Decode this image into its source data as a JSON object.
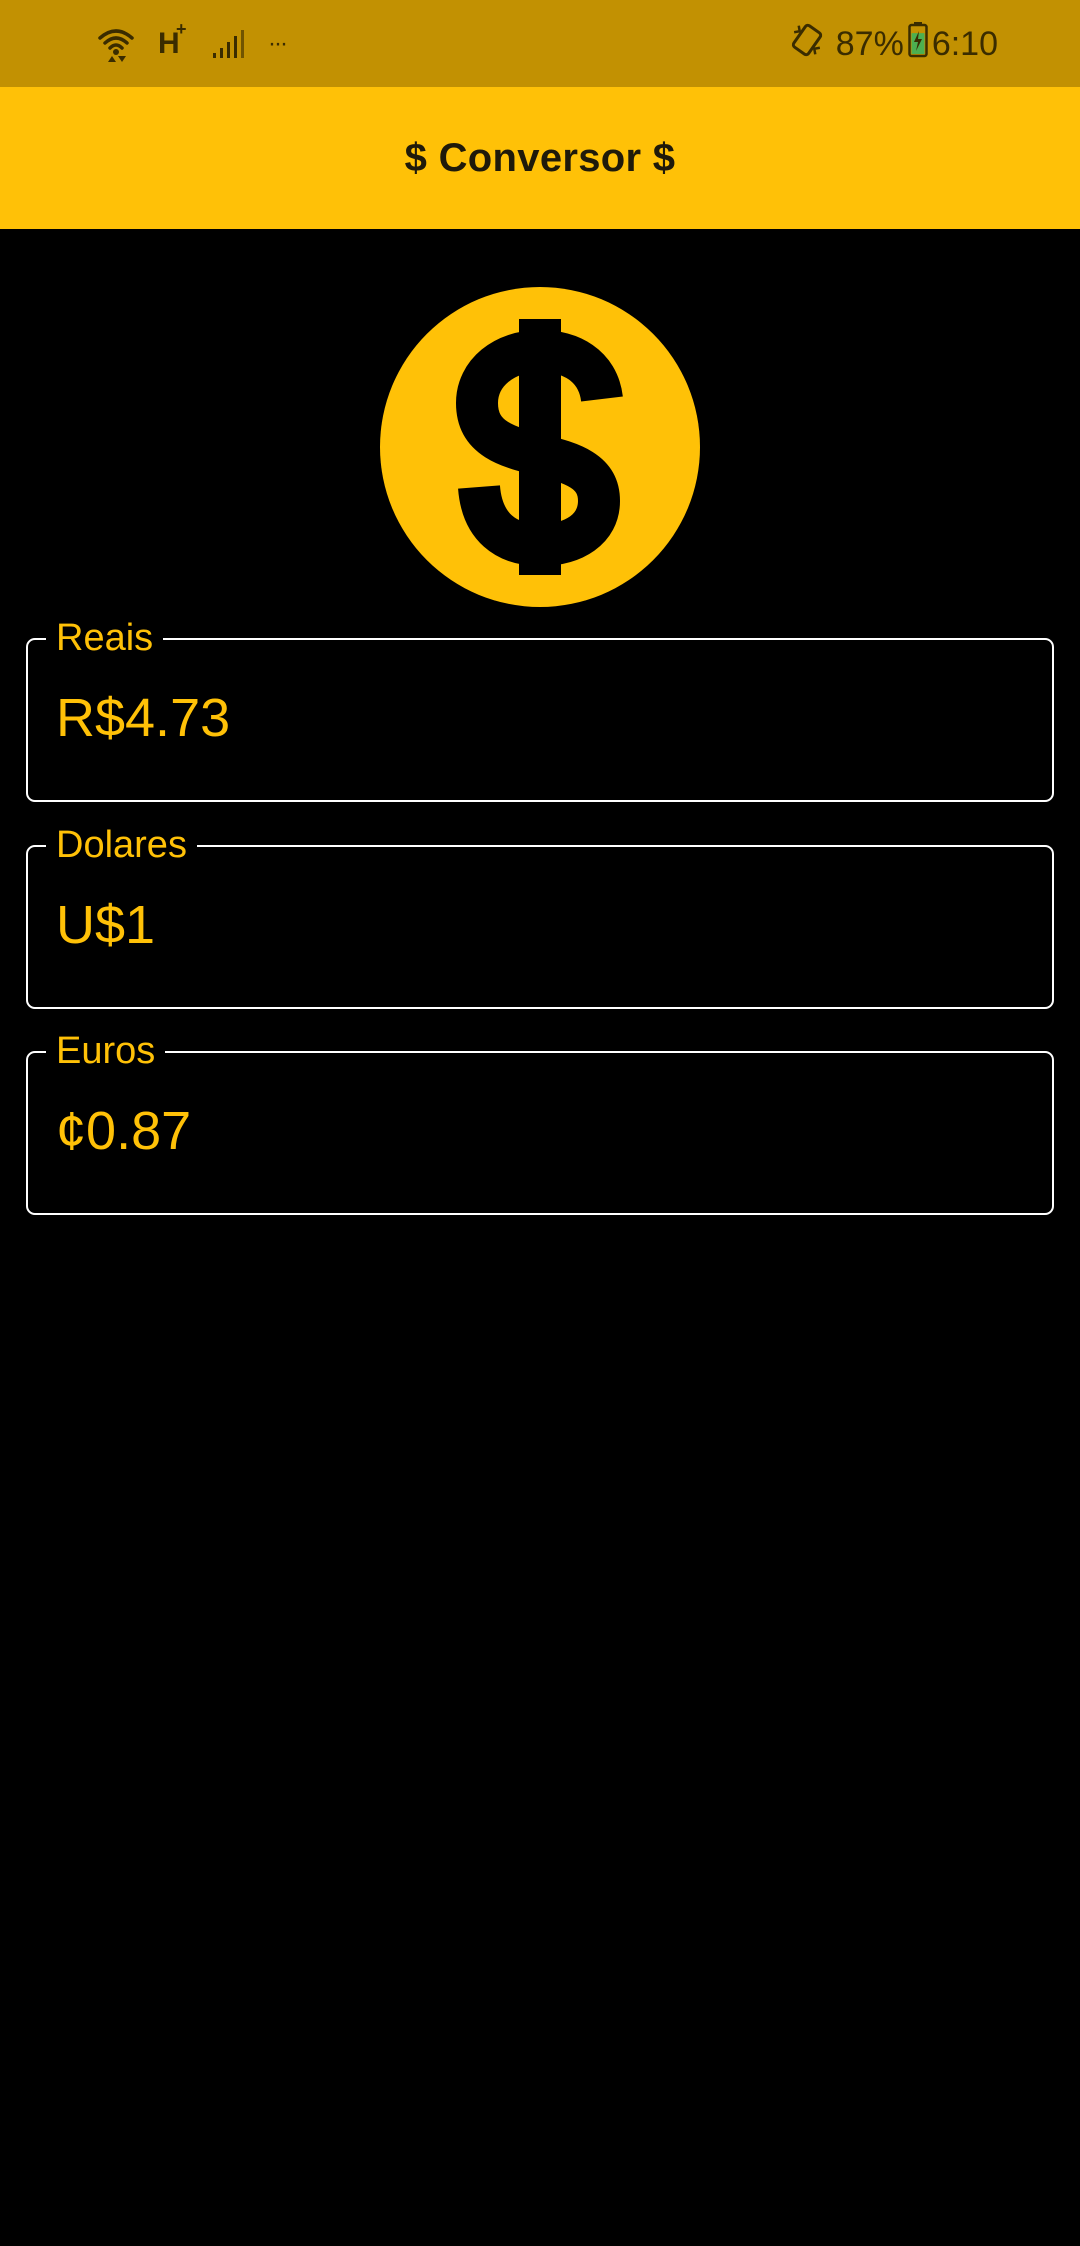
{
  "status_bar": {
    "icons": [
      "wifi-icon",
      "network-h-plus-icon",
      "signal-bars-icon",
      "more-notifications-icon",
      "vibrate-icon",
      "battery-charging-icon"
    ],
    "network_label": "H",
    "network_superscript": "+",
    "more_label": "···",
    "battery_percent": "87%",
    "battery_level": 0.87,
    "time": "6:10",
    "colors": {
      "background": "#C29102",
      "foreground": "#3a2c00",
      "battery_fill": "#4CAF50"
    }
  },
  "app_bar": {
    "title": "$ Conversor $",
    "background": "#FFC107"
  },
  "hero": {
    "icon": "dollar-coin-icon",
    "color": "#FFC107"
  },
  "fields": [
    {
      "label": "Reais",
      "value": "R$4.73"
    },
    {
      "label": "Dolares",
      "value": "U$1"
    },
    {
      "label": "Euros",
      "value": "¢0.87"
    }
  ],
  "theme": {
    "accent": "#FFC107",
    "background": "#000000",
    "border": "#FFFFFF"
  }
}
